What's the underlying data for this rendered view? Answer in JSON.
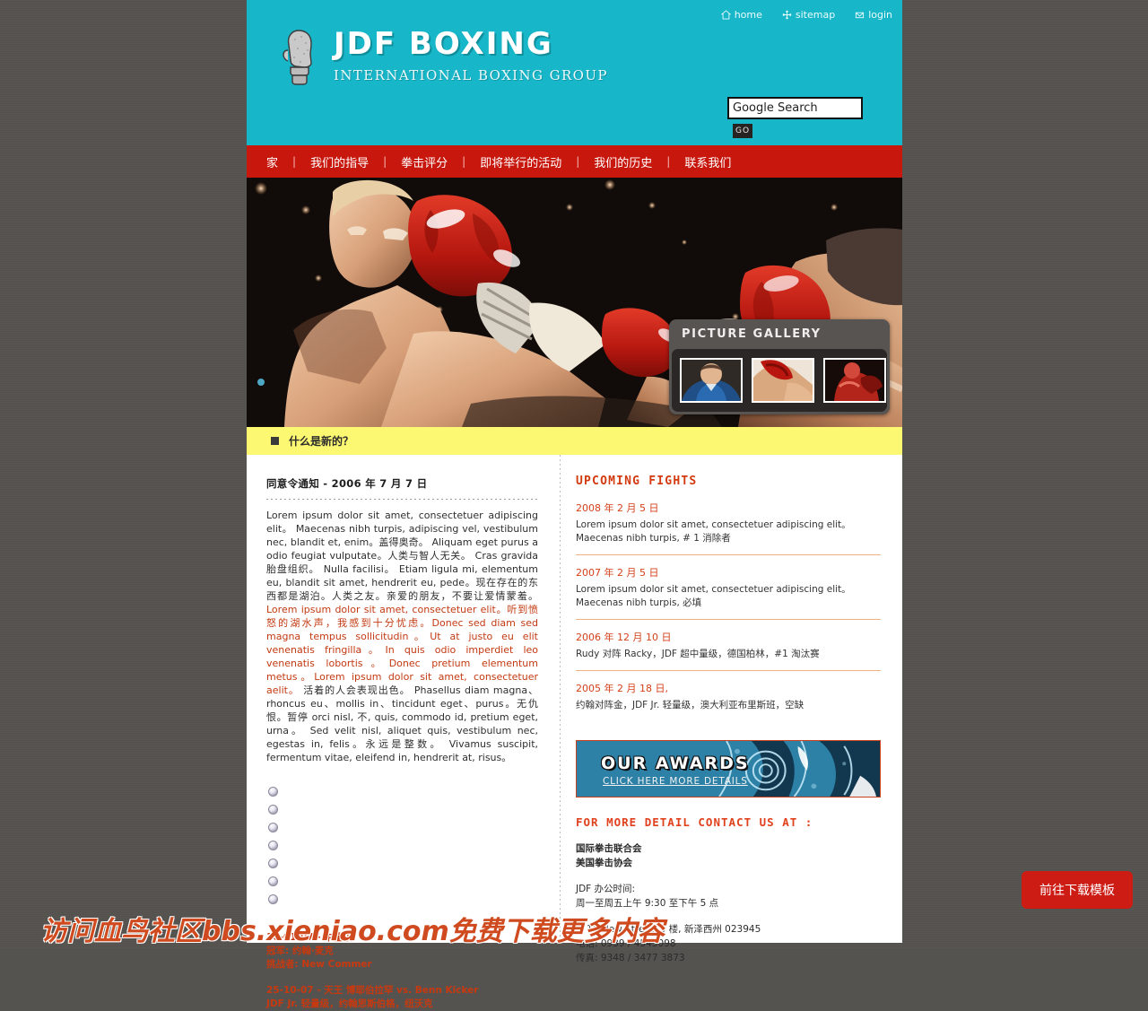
{
  "colors": {
    "header_teal": "#17b6c8",
    "nav_red": "#c8170d",
    "whatsnew_yellow": "#fdf871",
    "accent_orange": "#d4401a",
    "page_bg": "#555350",
    "download_btn": "#cc1c14"
  },
  "header": {
    "toplinks": [
      {
        "label": "home",
        "icon": "home-icon"
      },
      {
        "label": "sitemap",
        "icon": "sitemap-icon"
      },
      {
        "label": "login",
        "icon": "login-icon"
      }
    ],
    "brand_title": "JDF BOXING",
    "brand_subtitle": "INTERNATIONAL BOXING GROUP",
    "logo_icon": "boxing-glove-icon",
    "search_value": "Google Search",
    "search_placeholder": "Google Search",
    "go_label": "GO"
  },
  "nav": {
    "items": [
      {
        "label": "家"
      },
      {
        "label": "我们的指导"
      },
      {
        "label": "拳击评分"
      },
      {
        "label": "即将举行的活动"
      },
      {
        "label": "我们的历史"
      },
      {
        "label": "联系我们"
      }
    ],
    "separator": "|"
  },
  "hero": {
    "image_alt": "boxing-match-photo",
    "gallery_title": "PICTURE GALLERY",
    "thumbs": [
      {
        "alt": "boxer-portrait-thumbnail"
      },
      {
        "alt": "boxing-punch-thumbnail"
      },
      {
        "alt": "boxer-flexing-thumbnail"
      }
    ]
  },
  "whatsnew": {
    "label": "什么是新的？"
  },
  "article": {
    "title": "同意令通知 - 2006 年 7 月 7 日",
    "p1": "Lorem ipsum dolor sit amet, consectetuer adipiscing elit。 Maecenas nibh turpis, adipiscing vel, vestibulum nec, blandit et, enim。盖得奥奇。 Aliquam eget purus a odio feugiat vulputate。人类与智人无关。 Cras gravida 胎盘组织。 Nulla facilisi。 Etiam ligula mi, elementum eu, blandit sit amet, hendrerit eu, pede。现在存在的东西都是湖泊。人类之友。亲爱的朋友，不要让爱情蒙羞。 ",
    "p1_highlight": "Lorem ipsum dolor sit amet, consectetuer elit。听到愤怒的湖水声，我感到十分忧虑。Donec sed diam sed magna tempus sollicitudin。Ut at justo eu elit venenatis fringilla。In quis odio imperdiet leo venenatis lobortis。Donec pretium elementum metus。Lorem ipsum dolor sit amet, consectetuer aelit。",
    "p1_tail": " 活着的人会表现出色。 Phasellus diam magna、rhoncus eu、mollis in、tincidunt eget、purus。无仇恨。暂停 orci nisl, 不, quis, commodo id, pretium eget, urna。 Sed velit nisl, aliquet quis, vestibulum nec, egestas in, felis。永远是整数。 Vivamus suscipit, fermentum vitae, eleifend in, hendrerit at, risus。",
    "bullet_count": 7,
    "results": [
      {
        "date": "10-01-07 - 中量级",
        "line1": "冠军: 约翰·麦克",
        "line2": "挑战者: New Commer"
      },
      {
        "date": "25-10-07 - 天王 博耶伯拉罕 vs. Benn Kicker",
        "line1": "JDF Jr. 轻量级，约翰思斯伯格，纽沃克",
        "line2": ""
      }
    ]
  },
  "sidebar": {
    "upcoming_title": "UPCOMING FIGHTS",
    "fights": [
      {
        "date": "2008 年 2 月 5 日",
        "desc": "Lorem ipsum dolor sit amet, consectetuer adipiscing elit。Maecenas nibh turpis, # 1 消除者"
      },
      {
        "date": "2007 年 2 月 5 日",
        "desc": "Lorem ipsum dolor sit amet, consectetuer adipiscing elit。Maecenas nibh turpis, 必填"
      },
      {
        "date": "2006 年 12 月 10 日",
        "desc": "Rudy 对阵 Racky，JDF 超中量级，德国柏林，#1 淘汰赛"
      },
      {
        "date": "2005 年 2 月 18 日,",
        "desc": "约翰对阵金，JDF Jr. 轻量级，澳大利亚布里斯班，空缺"
      }
    ],
    "awards_title": "OUR AWARDS",
    "awards_link": "CLICK HERE MORE DETAILS",
    "contact_title": "FOR MORE DETAIL CONTACT US AT :",
    "org1": "国际拳击联合会",
    "org2": "美国拳击协会",
    "hours_label": "JDF 办公时间:",
    "hours_value": "周一至周五上午 9:30 至下午 5 点",
    "address": "# 16 New Street, 3 楼, 新泽西州 023945",
    "phone": "电话: 0939 / 4545098",
    "fax": "传真: 9348 / 3477 3873"
  },
  "overlay": {
    "watermark": "访问血鸟社区bbs.xieniao.com免费下载更多内容",
    "download_button": "前往下载模板"
  }
}
